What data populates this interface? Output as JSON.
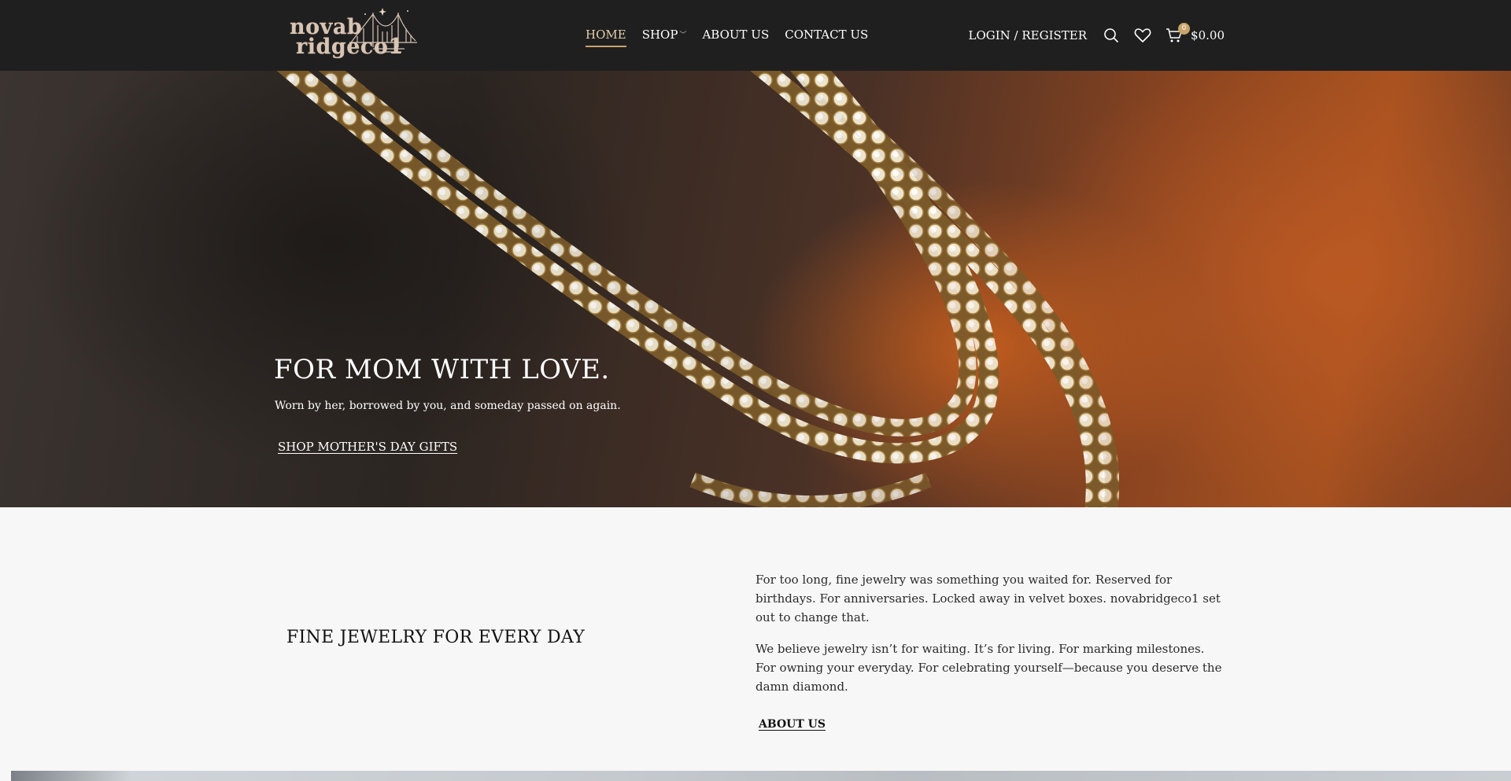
{
  "header": {
    "logo": {
      "line1": "novab",
      "line2": "ridgeco1"
    },
    "nav": [
      {
        "label": "HOME",
        "active": true
      },
      {
        "label": "SHOP",
        "has_dropdown": true
      },
      {
        "label": "ABOUT US"
      },
      {
        "label": "CONTACT US"
      }
    ],
    "login_label": "LOGIN / REGISTER",
    "icons": [
      "search-icon",
      "heart-icon",
      "cart-icon"
    ],
    "cart": {
      "count": "0",
      "total": "$0.00"
    }
  },
  "hero": {
    "title": "FOR MOM WITH LOVE.",
    "subtitle": "Worn by her, borrowed by you, and someday passed on again.",
    "cta_label": "SHOP MOTHER'S DAY GIFTS"
  },
  "about": {
    "heading": "FINE JEWELRY FOR EVERY DAY",
    "paragraph1": "For too long, fine jewelry was something you waited for. Reserved for birthdays. For anniversaries. Locked away in velvet boxes. novabridgeco1 set out to change that.",
    "paragraph2": "We believe jewelry isn’t for waiting. It’s for living. For marking milestones. For owning your everyday. For celebrating yourself—because you deserve the damn diamond.",
    "link_label": "ABOUT US"
  },
  "colors": {
    "header_bg": "#1f1f1f",
    "accent_gold": "#c9a46a",
    "page_bg": "#f7f7f7"
  }
}
